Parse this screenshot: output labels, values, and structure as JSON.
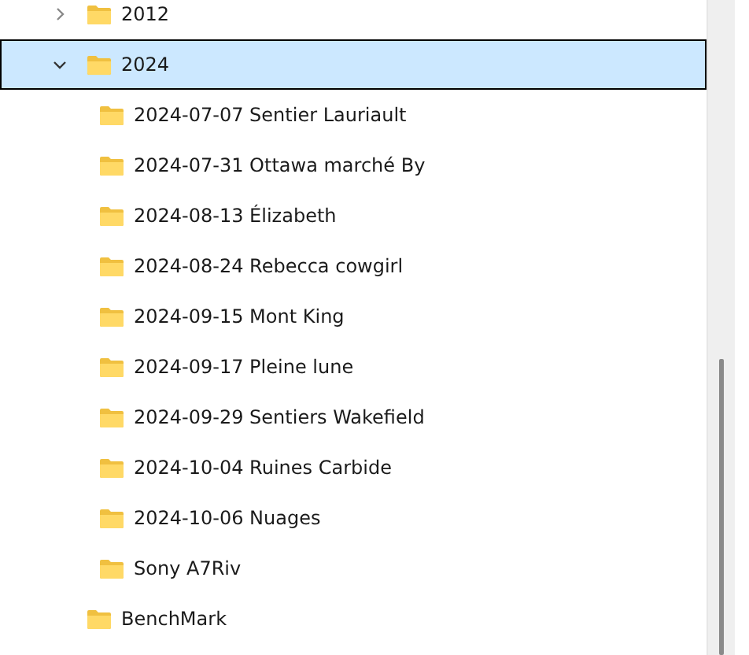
{
  "tree": [
    {
      "label": "2012",
      "expanded": false,
      "selected": false
    },
    {
      "label": "2024",
      "expanded": true,
      "selected": true,
      "children": [
        {
          "label": "2024-07-07 Sentier Lauriault",
          "selected": false
        },
        {
          "label": "2024-07-31 Ottawa marché By",
          "selected": false
        },
        {
          "label": "2024-08-13 Élizabeth",
          "selected": false
        },
        {
          "label": "2024-08-24 Rebecca cowgirl",
          "selected": false
        },
        {
          "label": "2024-09-15 Mont King",
          "selected": false
        },
        {
          "label": "2024-09-17 Pleine lune",
          "selected": false
        },
        {
          "label": "2024-09-29 Sentiers Wakefield",
          "selected": false
        },
        {
          "label": "2024-10-04 Ruines Carbide",
          "selected": false
        },
        {
          "label": "2024-10-06 Nuages",
          "selected": false
        },
        {
          "label": "Sony A7Riv",
          "selected": false
        }
      ]
    },
    {
      "label": "BenchMark",
      "selected": false
    }
  ]
}
